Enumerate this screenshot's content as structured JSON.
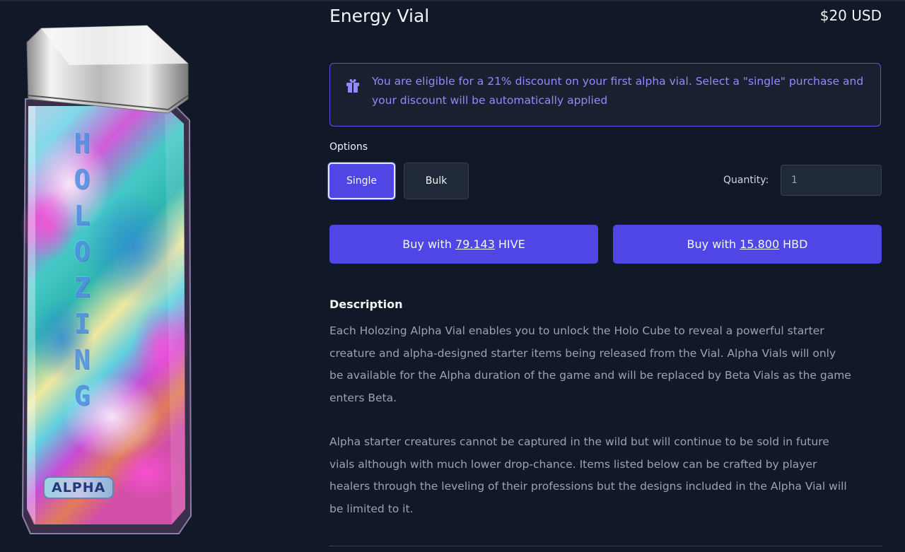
{
  "product": {
    "title": "Energy Vial",
    "price": "$20 USD",
    "bottle_text": [
      "H",
      "O",
      "L",
      "O",
      "Z",
      "I",
      "N",
      "G"
    ],
    "badge": "ALPHA"
  },
  "notice": {
    "icon": "gift-icon",
    "message": "You are eligible for a 21% discount on your first alpha vial. Select a \"single\" purchase and your discount will be automatically applied"
  },
  "options": {
    "label": "Options",
    "items": [
      {
        "label": "Single",
        "selected": true
      },
      {
        "label": "Bulk",
        "selected": false
      }
    ]
  },
  "quantity": {
    "label": "Quantity:",
    "value": "1"
  },
  "buy": {
    "hive": {
      "prefix": "Buy with",
      "amount": "79.143",
      "currency": "HIVE"
    },
    "hbd": {
      "prefix": "Buy with",
      "amount": "15.800",
      "currency": "HBD"
    }
  },
  "description": {
    "heading": "Description",
    "paragraphs": [
      "Each Holozing Alpha Vial enables you to unlock the Holo Cube to reveal a powerful starter creature and alpha-designed starter items being released from the Vial. Alpha Vials will only be available for the Alpha duration of the game and will be replaced by Beta Vials as the game enters Beta.",
      "Alpha starter creatures cannot be captured in the wild but will continue to be sold in future vials although with much lower drop-chance. Items listed below can be crafted by player healers through the leveling of their professions but the designs included in the Alpha Vial will be limited to it."
    ]
  },
  "colors": {
    "background": "#111827",
    "accent": "#4f46e5",
    "notice_text": "#8f8bff"
  }
}
